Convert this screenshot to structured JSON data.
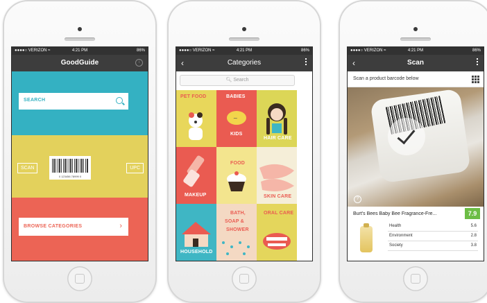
{
  "status_bar": {
    "carrier": "●●●●○ VERIZON ≈",
    "time": "4:21 PM",
    "battery": "86%"
  },
  "screen1": {
    "title": "GoodGuide",
    "search_label": "SEARCH",
    "scan_label": "SCAN",
    "upc_label": "UPC",
    "barcode_digits": "0 123456 78999 0",
    "browse_label": "BROWSE CATEGORIES",
    "colors": {
      "teal": "#34b1c2",
      "yellow": "#e3d15c",
      "coral": "#ec6455"
    }
  },
  "screen2": {
    "title": "Categories",
    "search_placeholder": "Search",
    "categories": [
      {
        "label": "PET FOOD"
      },
      {
        "label": "BABIES",
        "sub": "KIDS"
      },
      {
        "label": "HAIR CARE"
      },
      {
        "label": "MAKEUP"
      },
      {
        "label": "FOOD"
      },
      {
        "label": "SKIN CARE"
      },
      {
        "label": "HOUSEHOLD"
      },
      {
        "label": "BATH,",
        "line2": "SOAP &",
        "line3": "SHOWER"
      },
      {
        "label": "ORAL CARE"
      }
    ]
  },
  "screen3": {
    "title": "Scan",
    "instruction": "Scan a product barcode below",
    "product_name": "Burt's Bees Baby Bee Fragrance-Fre...",
    "overall_score": "7.9",
    "scores": [
      {
        "label": "Health",
        "value": "5.6"
      },
      {
        "label": "Environment",
        "value": "2.8"
      },
      {
        "label": "Society",
        "value": "3.8"
      }
    ],
    "accent": "#6cbd45"
  }
}
